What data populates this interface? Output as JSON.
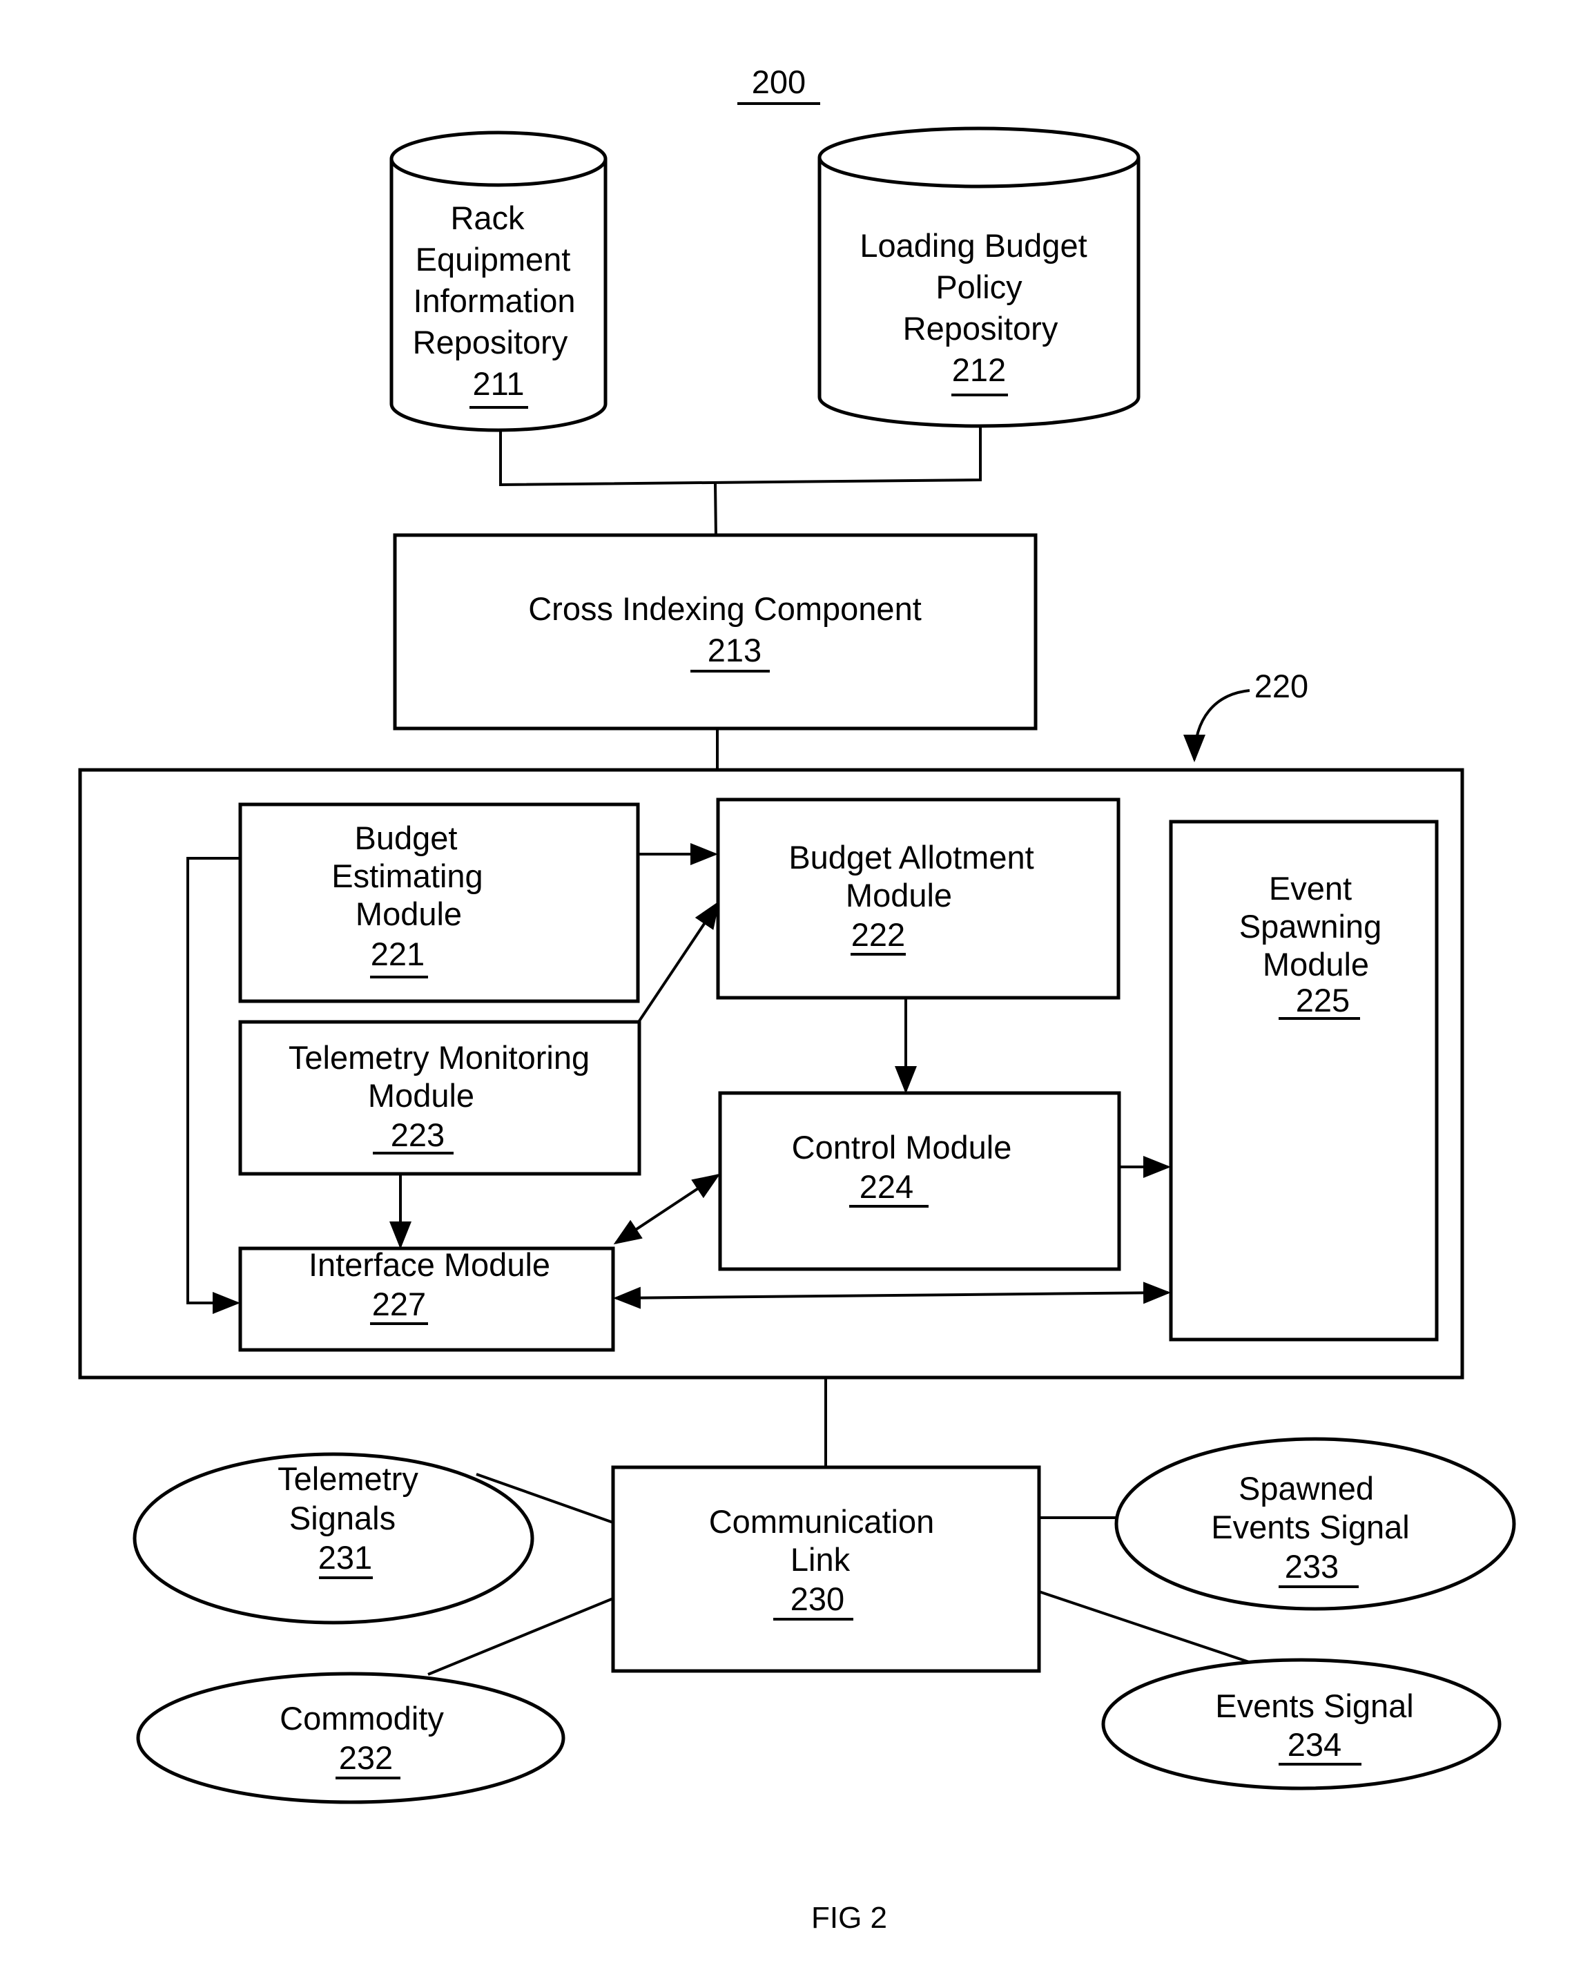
{
  "figure": {
    "ref_number": "200",
    "caption": "FIG 2"
  },
  "repositories": [
    {
      "id": "211",
      "lines": [
        "Rack",
        "Equipment",
        "Information",
        "Repository"
      ],
      "number": "211"
    },
    {
      "id": "212",
      "lines": [
        "Loading Budget",
        "Policy",
        "Repository"
      ],
      "number": "212"
    }
  ],
  "cross_indexing": {
    "lines": [
      "Cross Indexing Component"
    ],
    "number": "213"
  },
  "system_box": {
    "number": "220"
  },
  "modules": {
    "budget_estimating": {
      "lines": [
        "Budget",
        "Estimating",
        "Module"
      ],
      "number": "221"
    },
    "budget_allotment": {
      "lines": [
        "Budget Allotment",
        "Module"
      ],
      "number": "222"
    },
    "telemetry_monitoring": {
      "lines": [
        "Telemetry Monitoring",
        "Module"
      ],
      "number": "223"
    },
    "control": {
      "lines": [
        "Control Module"
      ],
      "number": "224"
    },
    "event_spawning": {
      "lines": [
        "Event",
        "Spawning",
        "Module"
      ],
      "number": "225"
    },
    "interface": {
      "lines": [
        "Interface Module"
      ],
      "number": "227"
    }
  },
  "communication_link": {
    "lines": [
      "Communication",
      "Link"
    ],
    "number": "230"
  },
  "signals": {
    "telemetry_signals": {
      "lines": [
        "Telemetry",
        "Signals"
      ],
      "number": "231"
    },
    "commodity": {
      "lines": [
        "Commodity"
      ],
      "number": "232"
    },
    "spawned_events_signal": {
      "lines": [
        "Spawned",
        "Events Signal"
      ],
      "number": "233"
    },
    "events_signal": {
      "lines": [
        "Events Signal"
      ],
      "number": "234"
    }
  }
}
